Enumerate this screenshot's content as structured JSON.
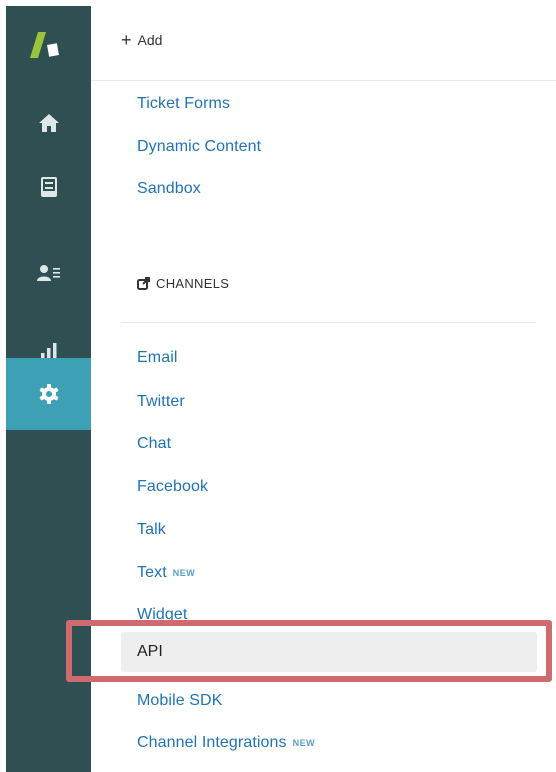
{
  "topbar": {
    "add_label": "Add"
  },
  "sidebar": {
    "items": [
      {
        "icon": "home-icon"
      },
      {
        "icon": "views-icon"
      },
      {
        "icon": "customers-icon"
      },
      {
        "icon": "reporting-icon"
      },
      {
        "icon": "gear-icon",
        "active": true
      }
    ]
  },
  "links_top": [
    "Ticket Forms",
    "Dynamic Content",
    "Sandbox"
  ],
  "channels": {
    "title": "CHANNELS",
    "items": [
      {
        "label": "Email"
      },
      {
        "label": "Twitter"
      },
      {
        "label": "Chat"
      },
      {
        "label": "Facebook"
      },
      {
        "label": "Talk"
      },
      {
        "label": "Text",
        "badge": "NEW"
      },
      {
        "label": "Widget"
      },
      {
        "label": "API",
        "selected": true
      },
      {
        "label": "Mobile SDK"
      },
      {
        "label": "Channel Integrations",
        "badge": "NEW"
      }
    ]
  },
  "colors": {
    "sidebar_bg": "#2f4f52",
    "active_nav": "#3ea0b5",
    "link": "#1f73b7",
    "highlight_border": "#cd6b6f"
  }
}
